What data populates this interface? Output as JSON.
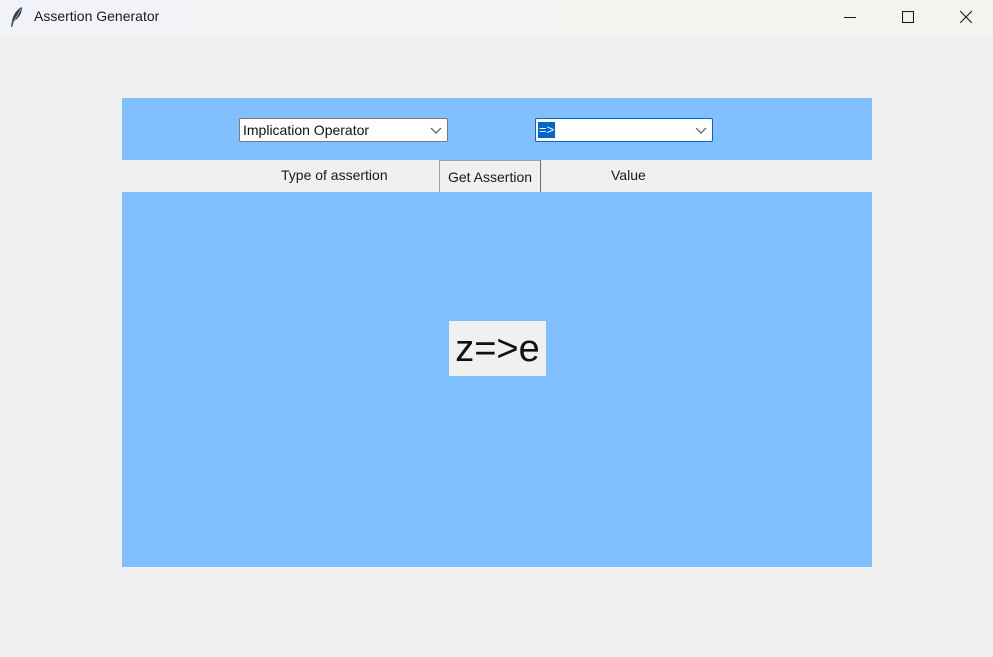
{
  "window": {
    "title": "Assertion Generator",
    "icons": {
      "app": "feather-icon",
      "minimize": "minimize-icon",
      "maximize": "maximize-icon",
      "close": "close-icon"
    }
  },
  "form": {
    "type_combo": {
      "value": "Implication Operator",
      "arrow_icon": "chevron-down-icon"
    },
    "value_combo": {
      "value": "=>",
      "arrow_icon": "chevron-down-icon"
    },
    "type_label": "Type of assertion",
    "value_label": "Value",
    "get_button_label": "Get Assertion"
  },
  "result": {
    "text": "z=>e"
  },
  "colors": {
    "panel_background": "#80c0ff",
    "window_background": "#f0f0f0",
    "selection_highlight": "#0066cc"
  }
}
